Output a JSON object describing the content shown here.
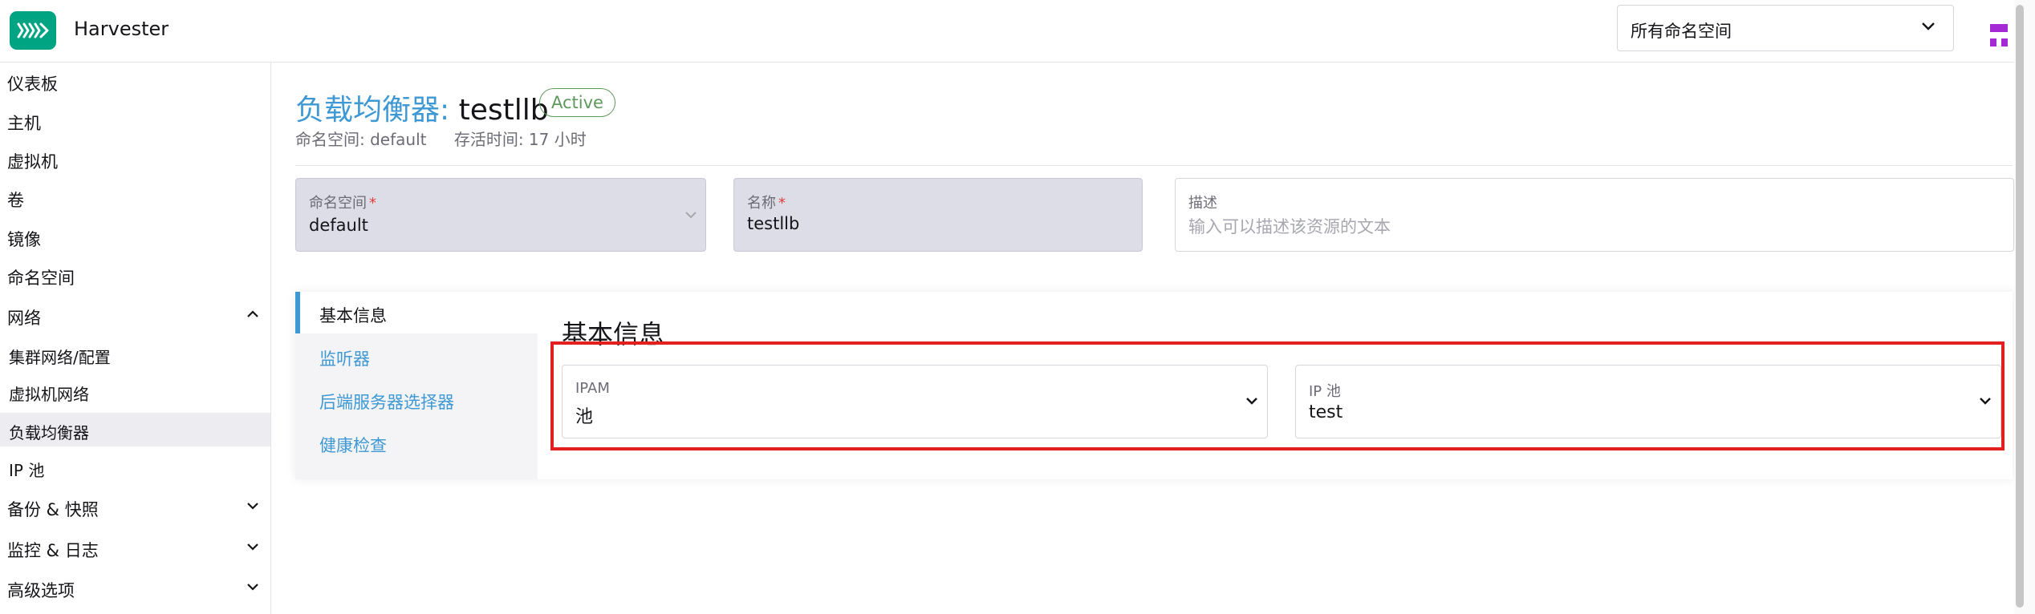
{
  "header": {
    "app_title": "Harvester",
    "namespace_selector": "所有命名空间",
    "brand_color": "#00a483"
  },
  "sidebar": {
    "items": [
      {
        "label": "仪表板"
      },
      {
        "label": "主机"
      },
      {
        "label": "虚拟机"
      },
      {
        "label": "卷"
      },
      {
        "label": "镜像"
      },
      {
        "label": "命名空间"
      },
      {
        "label": "网络",
        "expanded": true
      },
      {
        "label": "集群网络/配置"
      },
      {
        "label": "虚拟机网络"
      },
      {
        "label": "负载均衡器",
        "active": true
      },
      {
        "label": "IP 池"
      },
      {
        "label": "备份 & 快照"
      },
      {
        "label": "监控 & 日志"
      },
      {
        "label": "高级选项"
      }
    ]
  },
  "page": {
    "title_type": "负载均衡器:",
    "title_name": "testllb",
    "status": "Active",
    "namespace_meta": "命名空间: default",
    "age_meta": "存活时间: 17 小时"
  },
  "form": {
    "namespace": {
      "label": "命名空间",
      "required_mark": "*",
      "value": "default"
    },
    "name": {
      "label": "名称",
      "required_mark": "*",
      "value": "testllb"
    },
    "description": {
      "label": "描述",
      "placeholder": "输入可以描述该资源的文本"
    }
  },
  "tabs": [
    {
      "label": "基本信息",
      "active": true
    },
    {
      "label": "监听器"
    },
    {
      "label": "后端服务器选择器"
    },
    {
      "label": "健康检查"
    }
  ],
  "basic_info": {
    "section_title": "基本信息",
    "ipam": {
      "label": "IPAM",
      "value": "池"
    },
    "ip_pool": {
      "label": "IP 池",
      "value": "test"
    }
  },
  "colors": {
    "accent": "#3d98d3",
    "status_active": "#5d995d",
    "highlight": "#e4201f"
  }
}
